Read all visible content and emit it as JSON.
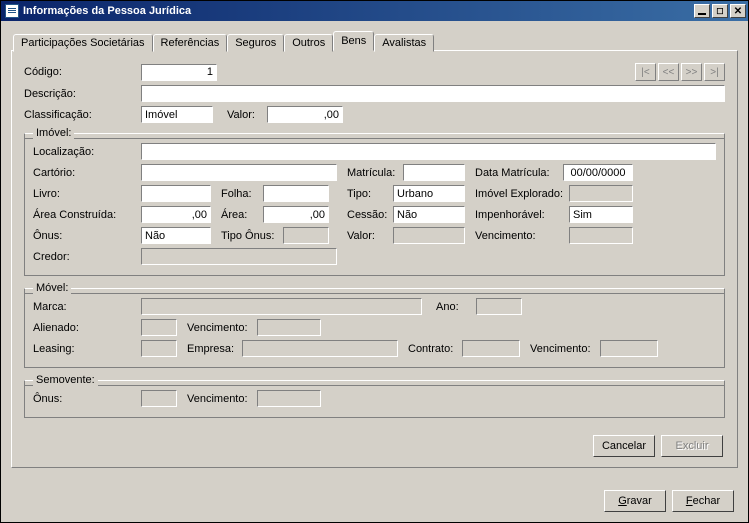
{
  "window": {
    "title": "Informações da Pessoa Jurídica"
  },
  "tabs": {
    "t0": "Participações Societárias",
    "t1": "Referências",
    "t2": "Seguros",
    "t3": "Outros",
    "t4": "Bens",
    "t5": "Avalistas"
  },
  "nav": {
    "first": "|<",
    "prev": "<<",
    "next": ">>",
    "last": ">|"
  },
  "labels": {
    "codigo": "Código:",
    "descricao": "Descrição:",
    "classificacao": "Classificação:",
    "valor": "Valor:",
    "localizacao": "Localização:",
    "cartorio": "Cartório:",
    "matricula": "Matrícula:",
    "data_matricula": "Data Matrícula:",
    "livro": "Livro:",
    "folha": "Folha:",
    "tipo": "Tipo:",
    "imovel_explorado": "Imóvel Explorado:",
    "area_construida": "Área Construída:",
    "area": "Área:",
    "cessao": "Cessão:",
    "impenhoravel": "Impenhorável:",
    "onus": "Ônus:",
    "tipo_onus": "Tipo Ônus:",
    "credor": "Credor:",
    "vencimento": "Vencimento:",
    "marca": "Marca:",
    "ano": "Ano:",
    "alienado": "Alienado:",
    "leasing": "Leasing:",
    "empresa": "Empresa:",
    "contrato": "Contrato:"
  },
  "groups": {
    "imovel": "Imóvel:",
    "movel": "Móvel:",
    "semovente": "Semovente:"
  },
  "values": {
    "codigo": "1",
    "descricao": "",
    "classificacao": "Imóvel",
    "valor": ",00",
    "localizacao": "",
    "cartorio": "",
    "matricula": "",
    "data_matricula": "00/00/0000",
    "livro": "",
    "folha": "",
    "tipo": "Urbano",
    "imovel_explorado": "",
    "area_construida": ",00",
    "area": ",00",
    "cessao": "Não",
    "impenhoravel": "Sim",
    "onus": "Não",
    "tipo_onus": "",
    "valor_onus": "",
    "venc_onus": "",
    "credor": "",
    "marca": "",
    "ano": "",
    "alienado": "",
    "venc_alienado": "",
    "leasing": "",
    "empresa": "",
    "contrato": "",
    "venc_leasing": "",
    "semovente_onus": "",
    "semovente_venc": ""
  },
  "buttons": {
    "cancelar": "Cancelar",
    "excluir": "Excluir",
    "gravar": "Gravar",
    "fechar": "Fechar",
    "gravar_u": "G",
    "gravar_rest": "ravar",
    "fechar_u": "F",
    "fechar_rest": "echar"
  }
}
